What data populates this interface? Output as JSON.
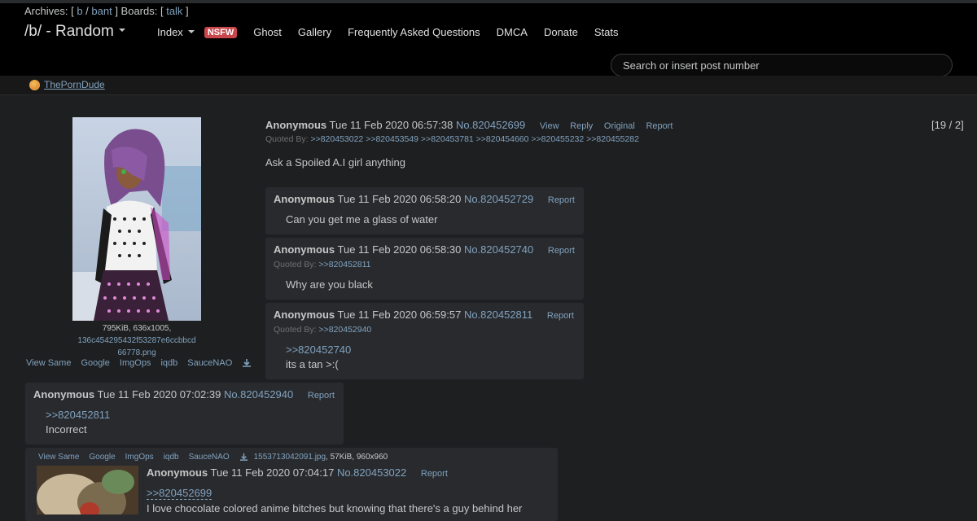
{
  "header": {
    "archives_label": "Archives:",
    "archives_links": [
      "b",
      "bant"
    ],
    "boards_label": "Boards:",
    "boards_links": [
      "talk"
    ],
    "board_title": "/b/ - Random",
    "nav": {
      "index": "Index",
      "nsfw": "NSFW",
      "ghost": "Ghost",
      "gallery": "Gallery",
      "faq": "Frequently Asked Questions",
      "dmca": "DMCA",
      "donate": "Donate",
      "stats": "Stats"
    },
    "search_placeholder": "Search or insert post number"
  },
  "ad": {
    "label": "ThePornDude"
  },
  "op": {
    "file_info": "795KiB, 636x1005,",
    "filename_line1": "136c454295432f53287e6ccbbcd",
    "filename_line2": "66778.png",
    "image_search": [
      "View Same",
      "Google",
      "ImgOps",
      "iqdb",
      "SauceNAO"
    ],
    "name": "Anonymous",
    "date": "Tue 11 Feb 2020 06:57:38",
    "number": "No.820452699",
    "controls": [
      "View",
      "Reply",
      "Original",
      "Report"
    ],
    "quoted_by_label": "Quoted By:",
    "quoted_by": ">>820453022 >>820453549 >>820453781 >>820454660 >>820455232 >>820455282",
    "text": "Ask a Spoiled A.I girl anything",
    "pager": "[19 / 2]"
  },
  "replies": [
    {
      "name": "Anonymous",
      "date": "Tue 11 Feb 2020 06:58:20",
      "number": "No.820452729",
      "report": "Report",
      "text": "Can you get me a glass of water"
    },
    {
      "name": "Anonymous",
      "date": "Tue 11 Feb 2020 06:58:30",
      "number": "No.820452740",
      "report": "Report",
      "quoted_by_label": "Quoted By:",
      "quoted_by": ">>820452811",
      "text": "Why are you black"
    },
    {
      "name": "Anonymous",
      "date": "Tue 11 Feb 2020 06:59:57",
      "number": "No.820452811",
      "report": "Report",
      "quoted_by_label": "Quoted By:",
      "quoted_by": ">>820452940",
      "quote_link": ">>820452740",
      "text": "its a tan >:("
    },
    {
      "name": "Anonymous",
      "date": "Tue 11 Feb 2020 07:02:39",
      "number": "No.820452940",
      "report": "Report",
      "quote_link": ">>820452811",
      "text": "Incorrect"
    },
    {
      "image_search": [
        "View Same",
        "Google",
        "ImgOps",
        "iqdb",
        "SauceNAO"
      ],
      "filename": "1553713042091.jpg",
      "file_info": ", 57KiB, 960x960",
      "name": "Anonymous",
      "date": "Tue 11 Feb 2020 07:04:17",
      "number": "No.820453022",
      "report": "Report",
      "quote_link": ">>820452699",
      "text": "I love chocolate colored anime bitches but knowing that there's a guy behind her"
    }
  ],
  "colors": {
    "link": "#81a2be",
    "nsfw_badge": "#c9474b",
    "post_bg": "#282a2e",
    "page_bg": "#1e1f21"
  }
}
